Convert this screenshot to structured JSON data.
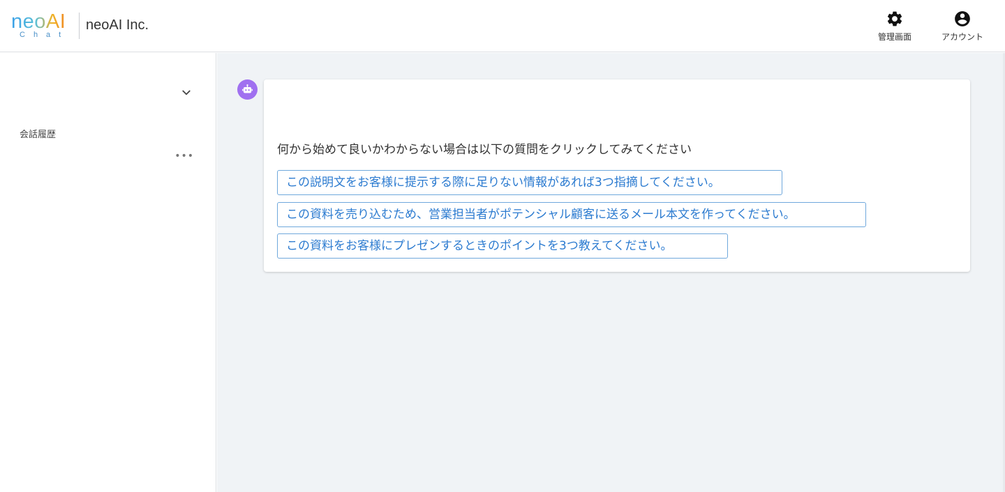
{
  "header": {
    "logo_text": "neoAI",
    "logo_sub": "Chat",
    "company": "neoAI Inc.",
    "admin_label": "管理画面",
    "account_label": "アカウント"
  },
  "sidebar": {
    "history_heading": "会話履歴",
    "more_label": "•••"
  },
  "chat": {
    "prompt": "何から始めて良いかわからない場合は以下の質問をクリックしてみてください",
    "suggestions": [
      "この説明文をお客様に提示する際に足りない情報があれば3つ指摘してください。",
      "この資料を売り込むため、営業担当者がポテンシャル顧客に送るメール本文を作ってください。",
      "この資料をお客様にプレゼンするときのポイントを3つ教えてください。"
    ]
  },
  "colors": {
    "accent": "#2c7bd0",
    "avatar": "#a070f0",
    "main_bg": "#f0f3f6"
  },
  "icons": {
    "admin": "gear-icon",
    "account": "account-circle-icon",
    "bot": "robot-icon",
    "collapse": "chevron-down-icon"
  }
}
